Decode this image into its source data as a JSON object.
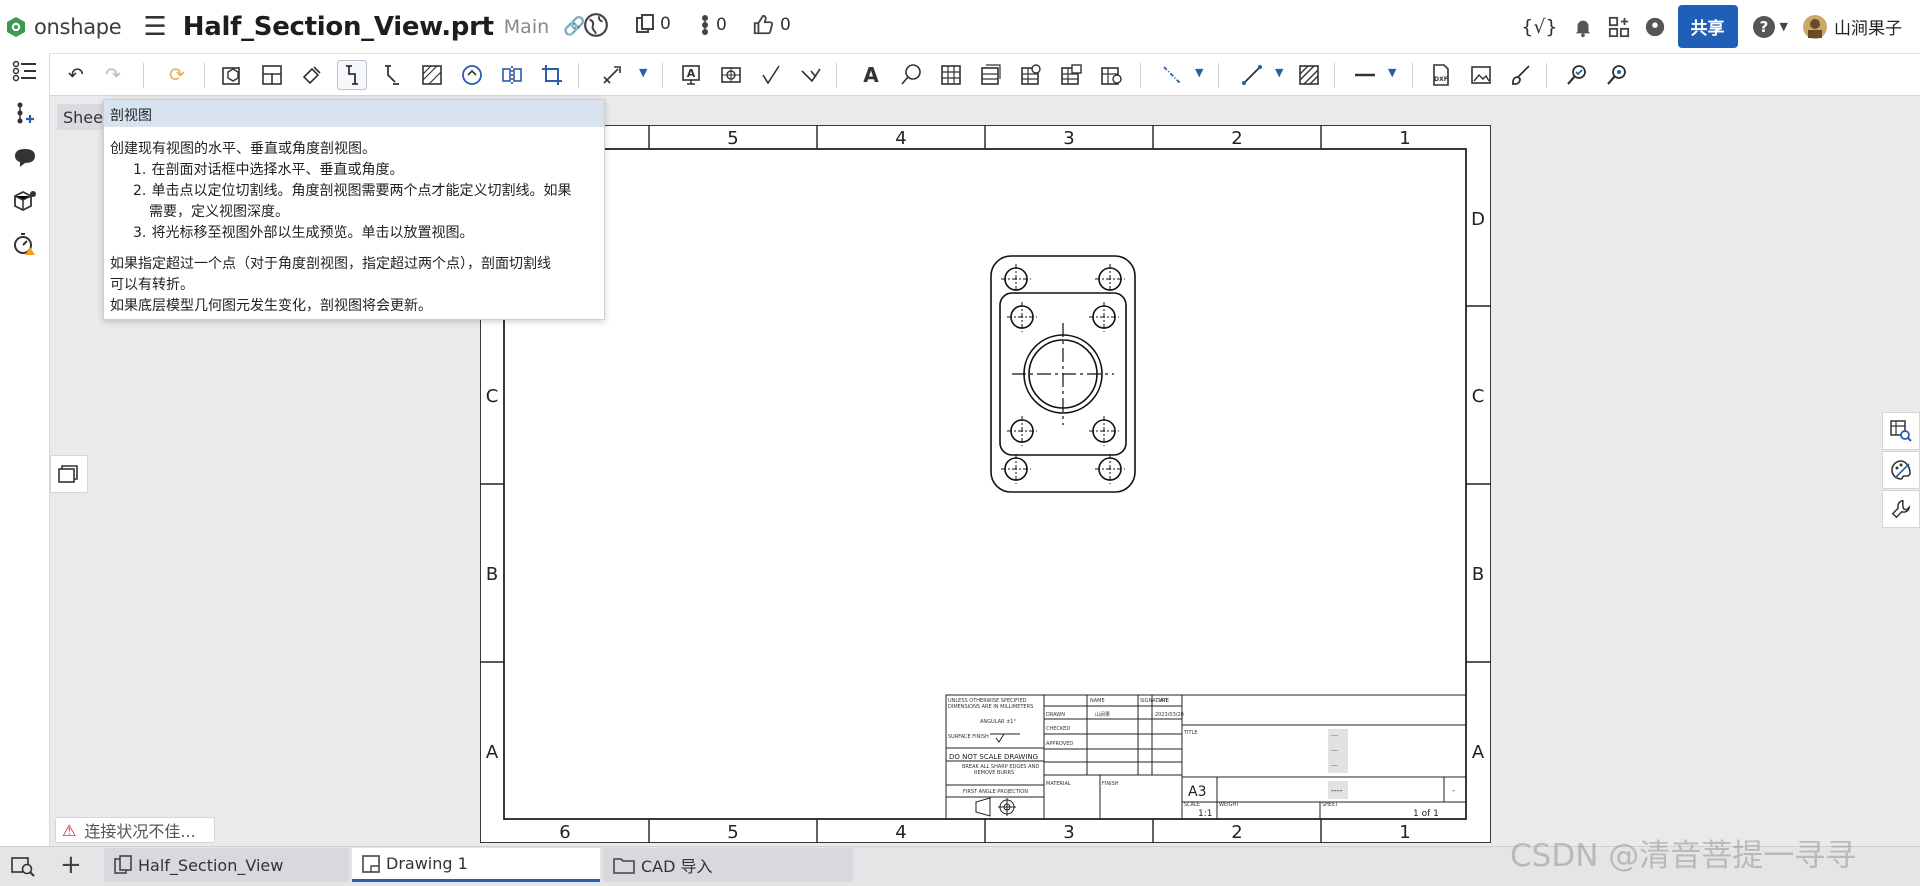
{
  "topbar": {
    "logo_text": "onshape",
    "doc_title": "Half_Section_View.prt",
    "branch": "Main",
    "counter_versions": "0",
    "counter_branches": "0",
    "counter_likes": "0",
    "share_label": "共享",
    "user_name": "山涧果子"
  },
  "sheet_tab_label": "Sheet",
  "tooltip": {
    "title": "剖视图",
    "intro": "创建现有视图的水平、垂直或角度剖视图。",
    "steps": [
      {
        "num": "1.",
        "text": "在剖面对话框中选择水平、垂直或角度。"
      },
      {
        "num": "2.",
        "text": "单击点以定位切割线。角度剖视图需要两个点才能定义切割线。如果",
        "cont": "需要，定义视图深度。"
      },
      {
        "num": "3.",
        "text": "将光标移至视图外部以生成预览。单击以放置视图。"
      }
    ],
    "para1": "如果指定超过一个点（对于角度剖视图，指定超过两个点），剖面切割线",
    "para1b": "可以有转折。",
    "para2": "如果底层模型几何图元发生变化，剖视图将会更新。"
  },
  "drawing": {
    "col_labels": [
      "5",
      "4",
      "3",
      "2",
      "1"
    ],
    "bottom_col_labels": [
      "6",
      "5",
      "4",
      "3",
      "2",
      "1"
    ],
    "row_labels": [
      "D",
      "C",
      "B",
      "A"
    ],
    "left_row_labels": [
      "C",
      "B",
      "A"
    ],
    "title_block": {
      "general_notes": [
        "UNLESS OTHERWISE SPECIFIED",
        "DIMENSIONS ARE IN MILLIMETERS",
        "ANGULAR ±1°"
      ],
      "surface_finish": "SURFACE FINISH",
      "do_not_scale": "DO NOT SCALE DRAWING",
      "break_edges": [
        "BREAK ALL SHARP EDGES AND",
        "REMOVE BURRS"
      ],
      "projection": "FIRST ANGLE PROJECTION",
      "hdr_name": "NAME",
      "hdr_signature": "SIGNATURE",
      "hdr_date": "DATE",
      "drawn": "DRAWN",
      "drawn_name": "山涧果",
      "drawn_date": "2023/03/20",
      "checked": "CHECKED",
      "approved": "APPROVED",
      "material": "MATERIAL",
      "finish": "FINISH",
      "title": "TITLE",
      "size": "A3",
      "dwg_no_dash": "----",
      "rev_dash": "-",
      "scale_label": "SCALE",
      "scale": "1:1",
      "weight": "WEIGHT",
      "sheet_label": "SHEET",
      "sheet": "1 of 1",
      "dashes": [
        "----",
        "----",
        "----"
      ]
    }
  },
  "status": {
    "connection": "连接状况不佳..."
  },
  "tabs": [
    {
      "label": "Half_Section_View"
    },
    {
      "label": "Drawing 1"
    },
    {
      "label": "CAD 导入"
    }
  ],
  "watermark": "CSDN @清音菩提一寻寻",
  "colors": {
    "share": "#1f5fb8",
    "accent": "#2a5db0",
    "tooltip_header": "#d8e3ef"
  }
}
